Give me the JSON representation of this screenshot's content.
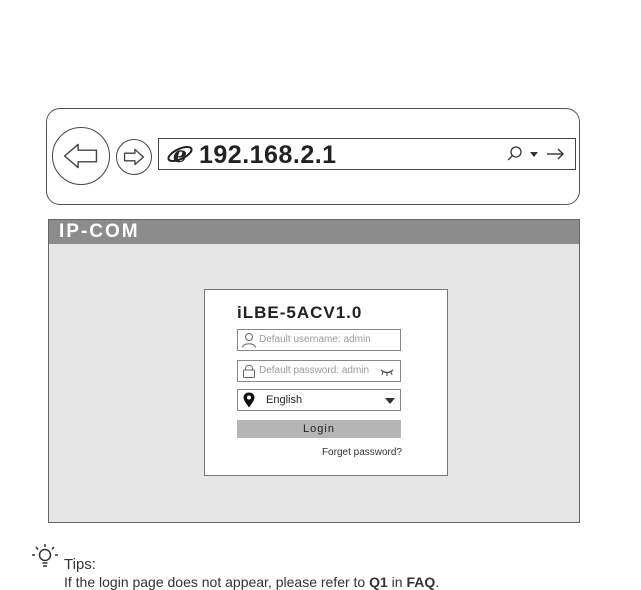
{
  "browser": {
    "url": "192.168.2.1"
  },
  "router": {
    "brand": "IP-COM",
    "model": "iLBE-5ACV1.0",
    "username_placeholder": "Default username: admin",
    "password_placeholder": "Default password: admin",
    "language": "English",
    "login_label": "Login",
    "forget_label": "Forget password?"
  },
  "tips": {
    "label": "Tips:",
    "text_prefix": "If the login page does not appear, please refer to ",
    "question": "Q1",
    "text_middle": " in ",
    "faq": "FAQ",
    "text_suffix": "."
  },
  "colors": {
    "brand_bar": "#8c8c8c",
    "page_bg": "#e6e6e6",
    "login_button": "#b5b5b5"
  },
  "icons": [
    "back-arrow-icon",
    "forward-arrow-icon",
    "ie-logo-icon",
    "search-icon",
    "dropdown-arrow-icon",
    "go-arrow-icon",
    "user-icon",
    "lock-icon",
    "eye-hidden-icon",
    "location-pin-icon",
    "chevron-down-icon",
    "lightbulb-icon"
  ]
}
